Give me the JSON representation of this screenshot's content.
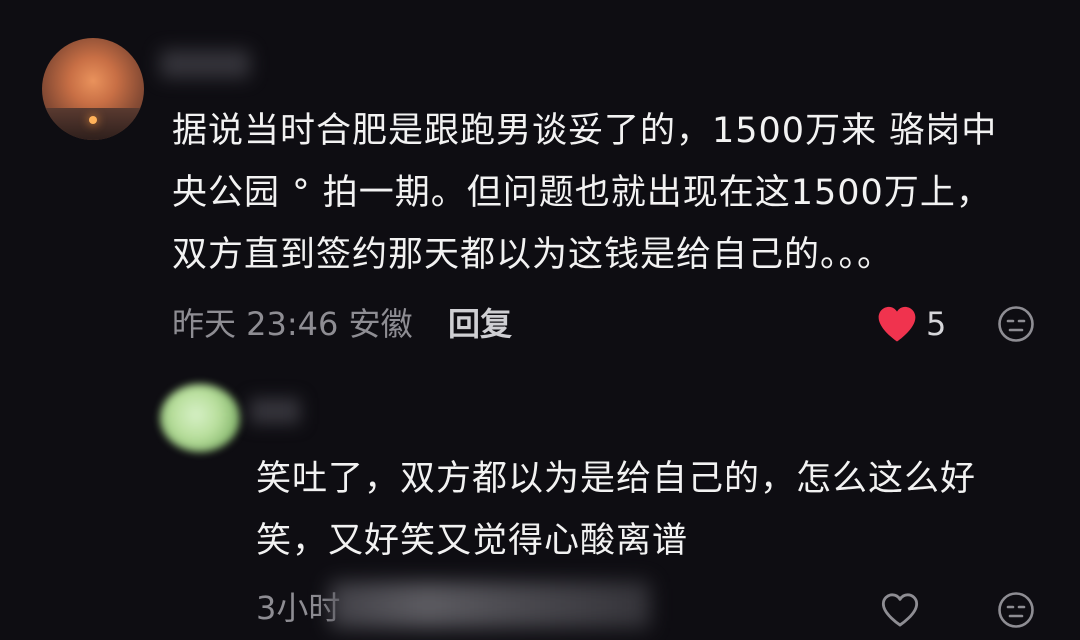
{
  "comments": [
    {
      "text": "据说当时合肥是跟跑男谈妥了的，1500万来 骆岗中\n央公园 ° 拍一期。但问题也就出现在这1500万上，\n双方直到签约那天都以为这钱是给自己的。。。",
      "meta": "昨天 23:46 安徽",
      "reply_label": "回复",
      "like_count": "5",
      "liked": true
    },
    {
      "text": "笑吐了，双方都以为是给自己的，怎么这么好\n笑，又好笑又觉得心酸离谱",
      "meta": "3小时",
      "liked": false
    }
  ],
  "icons": {
    "heart_filled": "heart-icon",
    "heart_outline": "heart-outline-icon",
    "dislike": "dislike-face-icon"
  },
  "colors": {
    "background": "#0e0d12",
    "text": "#f2f2f2",
    "meta": "#8e8d93",
    "heart": "#f0334e"
  }
}
